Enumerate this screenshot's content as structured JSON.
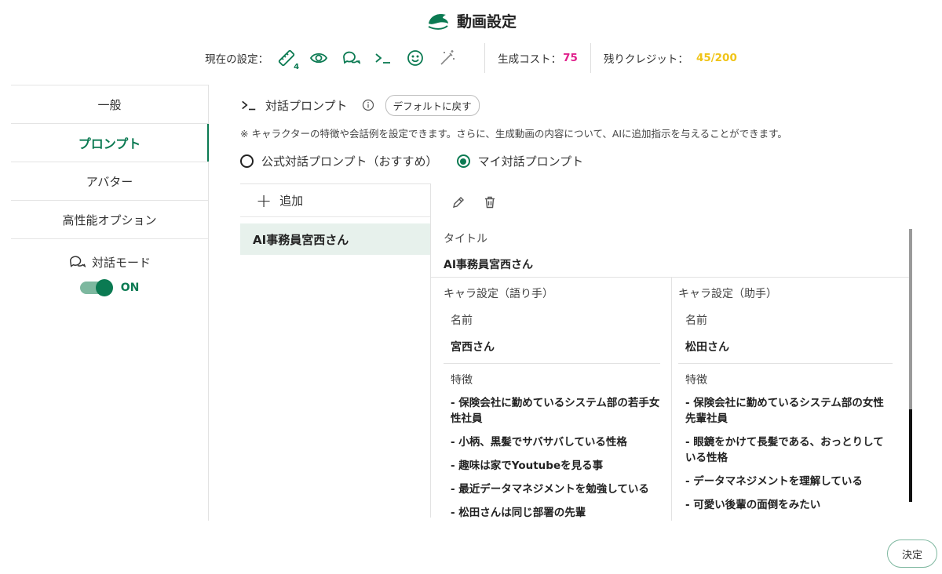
{
  "header": {
    "title": "動画設定",
    "current_label": "現在の設定：",
    "icons": [
      "ruler-icon",
      "eye-icon",
      "chat-icon",
      "terminal-icon",
      "smile-icon",
      "magic-wand-icon"
    ],
    "ruler_badge": "4",
    "cost_label": "生成コスト：",
    "cost_value": "75",
    "credit_label": "残りクレジット：",
    "credit_value": "45/200",
    "colors": {
      "accent": "#0b7a52",
      "cost": "#e0208c",
      "credit": "#f0c418"
    }
  },
  "sidebar": {
    "items": [
      {
        "label": "一般",
        "active": false
      },
      {
        "label": "プロンプト",
        "active": true
      },
      {
        "label": "アバター",
        "active": false
      },
      {
        "label": "高性能オプション",
        "active": false
      }
    ],
    "mode_label": "対話モード",
    "toggle_label": "ON",
    "toggle_on": true
  },
  "main": {
    "section_title": "対話プロンプト",
    "default_button": "デフォルトに戻す",
    "note": "※ キャラクターの特徴や会話例を設定できます。さらに、生成動画の内容について、AIに追加指示を与えることができます。",
    "radio_official": "公式対話プロンプト（おすすめ）",
    "radio_mine": "マイ対話プロンプト",
    "selected_radio": "mine",
    "add_label": "追加",
    "list_items": [
      "AI事務員宮西さん"
    ],
    "detail": {
      "title_label": "タイトル",
      "title_value": "AI事務員宮西さん",
      "narrator": {
        "header": "キャラ設定（語り手）",
        "name_label": "名前",
        "name_value": "宮西さん",
        "traits_label": "特徴",
        "traits": [
          "- 保険会社に勤めているシステム部の若手女性社員",
          "- 小柄、黒髪でサバサバしている性格",
          "- 趣味は家でYoutubeを見る事",
          "- 最近データマネジメントを勉強している",
          "- 松田さんは同じ部署の先輩"
        ]
      },
      "assistant": {
        "header": "キャラ設定（助手）",
        "name_label": "名前",
        "name_value": "松田さん",
        "traits_label": "特徴",
        "traits": [
          "- 保険会社に勤めているシステム部の女性先輩社員",
          "- 眼鏡をかけて長髪である、おっとりしている性格",
          "- データマネジメントを理解している",
          "- 可愛い後輩の面倒をみたい"
        ]
      }
    }
  },
  "footer": {
    "done_label": "決定"
  }
}
